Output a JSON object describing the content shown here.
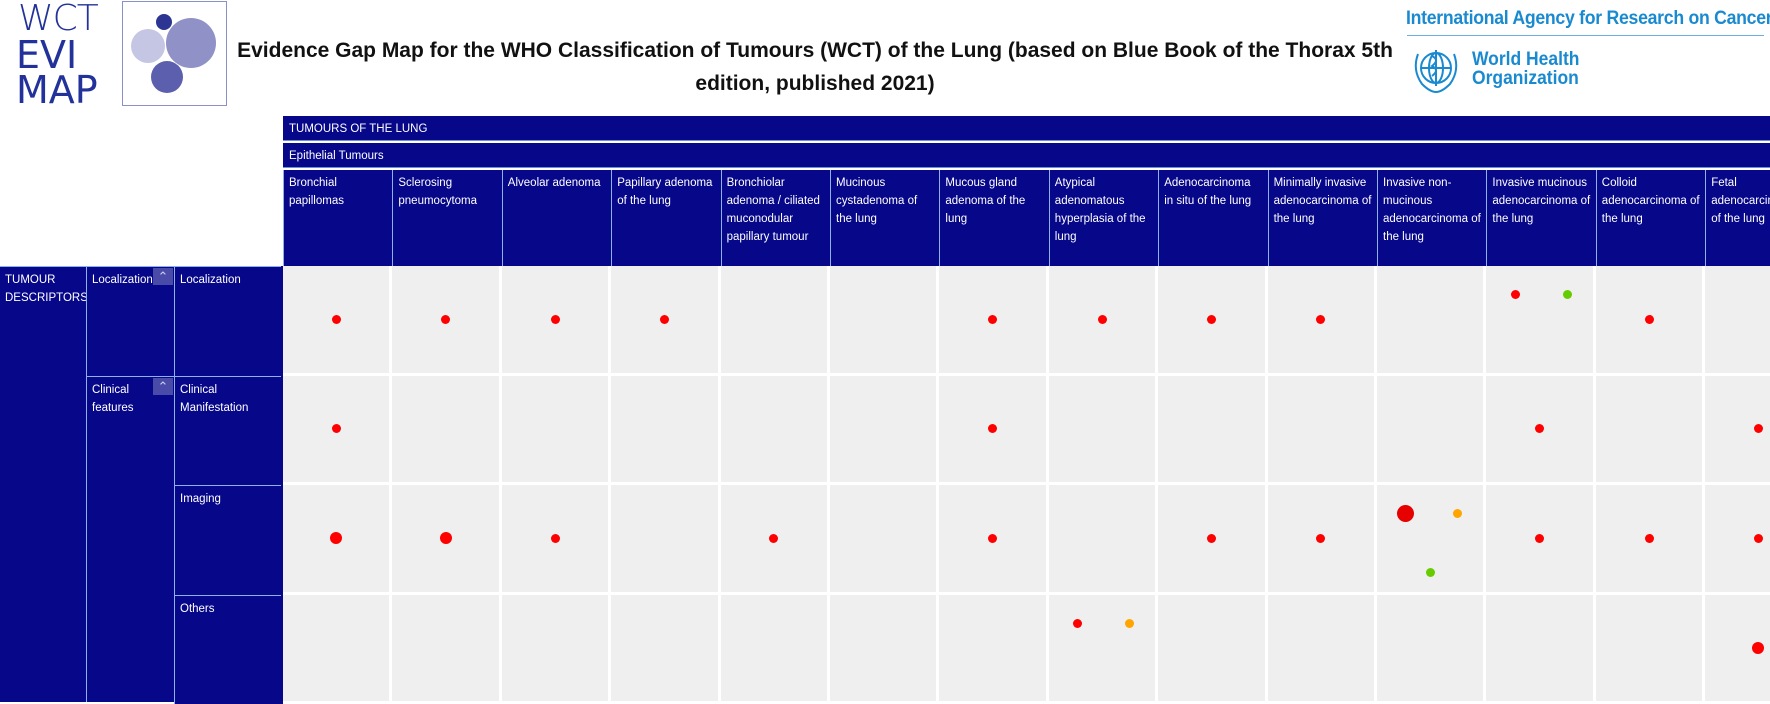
{
  "header": {
    "logo": {
      "line1": "WCT",
      "line2": "EVI",
      "line3": "MAP"
    },
    "title": "Evidence Gap Map for the WHO Classification of Tumours (WCT) of the Lung (based on Blue Book of the Thorax 5th edition, published 2021)",
    "partner1": "International Agency for Research on Cancer",
    "partner2_line1": "World Health",
    "partner2_line2": "Organization"
  },
  "colors": {
    "header_bg": "#07078a",
    "cell_bg": "#efefef",
    "dot_red": "#ff0000",
    "dot_darkred": "#e60000",
    "dot_orange": "#ffa500",
    "dot_green": "#66cc00",
    "brand_blue": "#1a8ad0",
    "logo_blue": "#23329a"
  },
  "chart_data": {
    "type": "bubble-matrix",
    "title": "Evidence Gap Map for the WHO Classification of Tumours (WCT) of the Lung (based on Blue Book of the Thorax 5th edition, published 2021)",
    "top_header": "TUMOURS OF THE LUNG",
    "column_group": "Epithelial Tumours",
    "columns": [
      "Bronchial papillomas",
      "Sclerosing pneumocytoma",
      "Alveolar adenoma",
      "Papillary adenoma of the lung",
      "Bronchiolar adenoma / ciliated muconodular papillary tumour",
      "Mucinous cystadenoma of the lung",
      "Mucous gland adenoma of the lung",
      "Atypical adenomatous hyperplasia of the lung",
      "Adenocarcinoma in situ of the lung",
      "Minimally invasive adenocarcinoma of the lung",
      "Invasive non-mucinous adenocarcinoma of the lung",
      "Invasive mucinous adenocarcinoma of the lung",
      "Colloid adenocarcinoma of the lung",
      "Fetal adenocarcinoma of the lung"
    ],
    "row_root": "TUMOUR DESCRIPTORS",
    "row_groups": [
      {
        "label": "Localization",
        "collapse_icon": "chevron-double-up",
        "rows": [
          "Localization"
        ]
      },
      {
        "label": "Clinical features",
        "collapse_icon": "chevron-double-up",
        "rows": [
          "Clinical Manifestation",
          "Imaging",
          "Others"
        ]
      }
    ],
    "rows": [
      "Localization",
      "Clinical Manifestation",
      "Imaging",
      "Others"
    ],
    "points": [
      {
        "row": 0,
        "col": 0,
        "color": "red",
        "size": "small",
        "pos": "center"
      },
      {
        "row": 0,
        "col": 1,
        "color": "red",
        "size": "small",
        "pos": "center"
      },
      {
        "row": 0,
        "col": 2,
        "color": "red",
        "size": "small",
        "pos": "center"
      },
      {
        "row": 0,
        "col": 3,
        "color": "red",
        "size": "small",
        "pos": "center"
      },
      {
        "row": 0,
        "col": 6,
        "color": "red",
        "size": "small",
        "pos": "center"
      },
      {
        "row": 0,
        "col": 7,
        "color": "red",
        "size": "small",
        "pos": "center"
      },
      {
        "row": 0,
        "col": 8,
        "color": "red",
        "size": "small",
        "pos": "center"
      },
      {
        "row": 0,
        "col": 9,
        "color": "red",
        "size": "small",
        "pos": "center"
      },
      {
        "row": 0,
        "col": 11,
        "color": "red",
        "size": "small",
        "pos": "top-left"
      },
      {
        "row": 0,
        "col": 11,
        "color": "green",
        "size": "small",
        "pos": "top-right"
      },
      {
        "row": 0,
        "col": 12,
        "color": "red",
        "size": "small",
        "pos": "center"
      },
      {
        "row": 1,
        "col": 0,
        "color": "red",
        "size": "small",
        "pos": "center"
      },
      {
        "row": 1,
        "col": 6,
        "color": "red",
        "size": "small",
        "pos": "center"
      },
      {
        "row": 1,
        "col": 11,
        "color": "red",
        "size": "small",
        "pos": "center"
      },
      {
        "row": 1,
        "col": 13,
        "color": "red",
        "size": "small",
        "pos": "center"
      },
      {
        "row": 2,
        "col": 0,
        "color": "red",
        "size": "medium",
        "pos": "center"
      },
      {
        "row": 2,
        "col": 1,
        "color": "red",
        "size": "medium",
        "pos": "center"
      },
      {
        "row": 2,
        "col": 2,
        "color": "red",
        "size": "small",
        "pos": "center"
      },
      {
        "row": 2,
        "col": 4,
        "color": "red",
        "size": "small",
        "pos": "center"
      },
      {
        "row": 2,
        "col": 6,
        "color": "red",
        "size": "small",
        "pos": "center"
      },
      {
        "row": 2,
        "col": 8,
        "color": "red",
        "size": "small",
        "pos": "center"
      },
      {
        "row": 2,
        "col": 9,
        "color": "red",
        "size": "small",
        "pos": "center"
      },
      {
        "row": 2,
        "col": 10,
        "color": "darkred",
        "size": "large",
        "pos": "top-left"
      },
      {
        "row": 2,
        "col": 10,
        "color": "orange",
        "size": "small",
        "pos": "top-right"
      },
      {
        "row": 2,
        "col": 10,
        "color": "green",
        "size": "small",
        "pos": "bottom-center"
      },
      {
        "row": 2,
        "col": 11,
        "color": "red",
        "size": "small",
        "pos": "center"
      },
      {
        "row": 2,
        "col": 12,
        "color": "red",
        "size": "small",
        "pos": "center"
      },
      {
        "row": 2,
        "col": 13,
        "color": "red",
        "size": "small",
        "pos": "center"
      },
      {
        "row": 3,
        "col": 7,
        "color": "red",
        "size": "small",
        "pos": "top-left"
      },
      {
        "row": 3,
        "col": 7,
        "color": "orange",
        "size": "small",
        "pos": "top-right"
      },
      {
        "row": 3,
        "col": 13,
        "color": "red",
        "size": "medium",
        "pos": "center"
      }
    ],
    "legend": []
  }
}
